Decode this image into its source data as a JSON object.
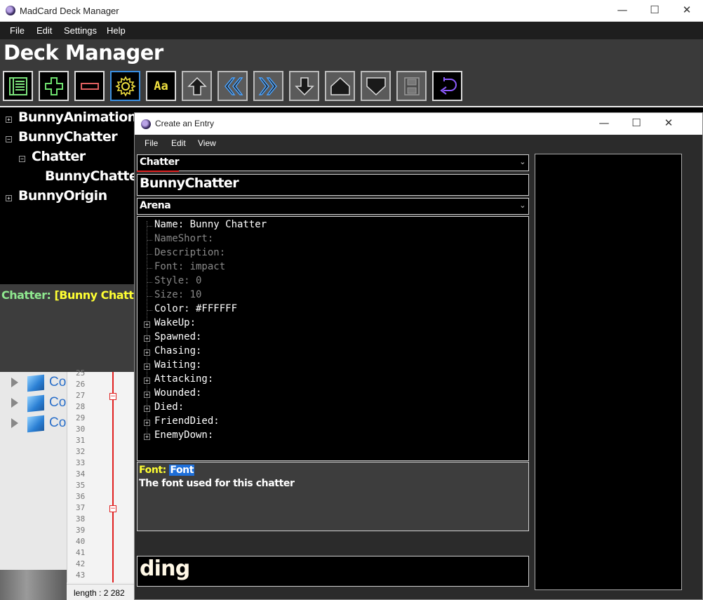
{
  "window": {
    "title": "MadCard Deck Manager",
    "minimize": "—",
    "maximize": "☐",
    "close": "✕"
  },
  "menu": [
    "File",
    "Edit",
    "Settings",
    "Help"
  ],
  "app_title": "Deck Manager",
  "toolbar": [
    {
      "name": "list-icon"
    },
    {
      "name": "add-icon"
    },
    {
      "name": "remove-icon"
    },
    {
      "name": "gear-icon"
    },
    {
      "name": "font-icon",
      "label": "Aa"
    },
    {
      "name": "arrow-up-icon"
    },
    {
      "name": "double-left-icon"
    },
    {
      "name": "double-right-icon"
    },
    {
      "name": "arrow-down-icon"
    },
    {
      "name": "move-top-icon"
    },
    {
      "name": "move-bottom-icon"
    },
    {
      "name": "save-icon"
    },
    {
      "name": "undo-icon"
    }
  ],
  "tree": [
    {
      "label": "BunnyAnimations",
      "expander": "+"
    },
    {
      "label": "BunnyChatter",
      "expander": "−"
    },
    {
      "label": "Chatter",
      "expander": "−"
    },
    {
      "label": "BunnyChatter",
      "expander": ""
    },
    {
      "label": "BunnyOrigin",
      "expander": "+"
    }
  ],
  "info": {
    "prefix": "Chatter: ",
    "value": "[Bunny Chatter]",
    "prefix_color": "#8fe88f",
    "value_color": "#ffff33"
  },
  "background_editor": {
    "line_numbers": [
      "25",
      "26",
      "27",
      "28",
      "29",
      "30",
      "31",
      "32",
      "33",
      "34",
      "35",
      "36",
      "37",
      "38",
      "39",
      "40",
      "41",
      "42",
      "43"
    ],
    "tree_items": [
      "Co",
      "Co",
      "Co"
    ],
    "status": "length : 2 282"
  },
  "dialog": {
    "title": "Create an Entry",
    "minimize": "—",
    "maximize": "☐",
    "close": "✕",
    "menu": [
      "File",
      "Edit",
      "View"
    ],
    "type_dropdown": "Chatter",
    "name_value": "BunnyChatter",
    "category_dropdown": "Arena",
    "properties": [
      {
        "text": "Name: Bunny Chatter",
        "enabled": true,
        "expandable": false
      },
      {
        "text": "NameShort:",
        "enabled": false,
        "expandable": false
      },
      {
        "text": "Description:",
        "enabled": false,
        "expandable": false
      },
      {
        "text": "Font: impact",
        "enabled": false,
        "expandable": false
      },
      {
        "text": "Style: 0",
        "enabled": false,
        "expandable": false
      },
      {
        "text": "Size: 10",
        "enabled": false,
        "expandable": false
      },
      {
        "text": "Color: #FFFFFF",
        "enabled": true,
        "expandable": false
      },
      {
        "text": "WakeUp:",
        "enabled": true,
        "expandable": true
      },
      {
        "text": "Spawned:",
        "enabled": true,
        "expandable": true
      },
      {
        "text": "Chasing:",
        "enabled": true,
        "expandable": true
      },
      {
        "text": "Waiting:",
        "enabled": true,
        "expandable": true
      },
      {
        "text": "Attacking:",
        "enabled": true,
        "expandable": true
      },
      {
        "text": "Wounded:",
        "enabled": true,
        "expandable": true
      },
      {
        "text": "Died:",
        "enabled": true,
        "expandable": true
      },
      {
        "text": "FriendDied:",
        "enabled": true,
        "expandable": true
      },
      {
        "text": "EnemyDown:",
        "enabled": true,
        "expandable": true
      }
    ],
    "description": {
      "label": "Font: ",
      "link": "Font",
      "text": "The font used for this chatter",
      "label_color": "#ffff33",
      "link_bg": "#1e6fd9"
    },
    "input_text": "ding"
  },
  "colors": {
    "accent_red": "#e02020",
    "selected_border": "#3b8fe0"
  }
}
